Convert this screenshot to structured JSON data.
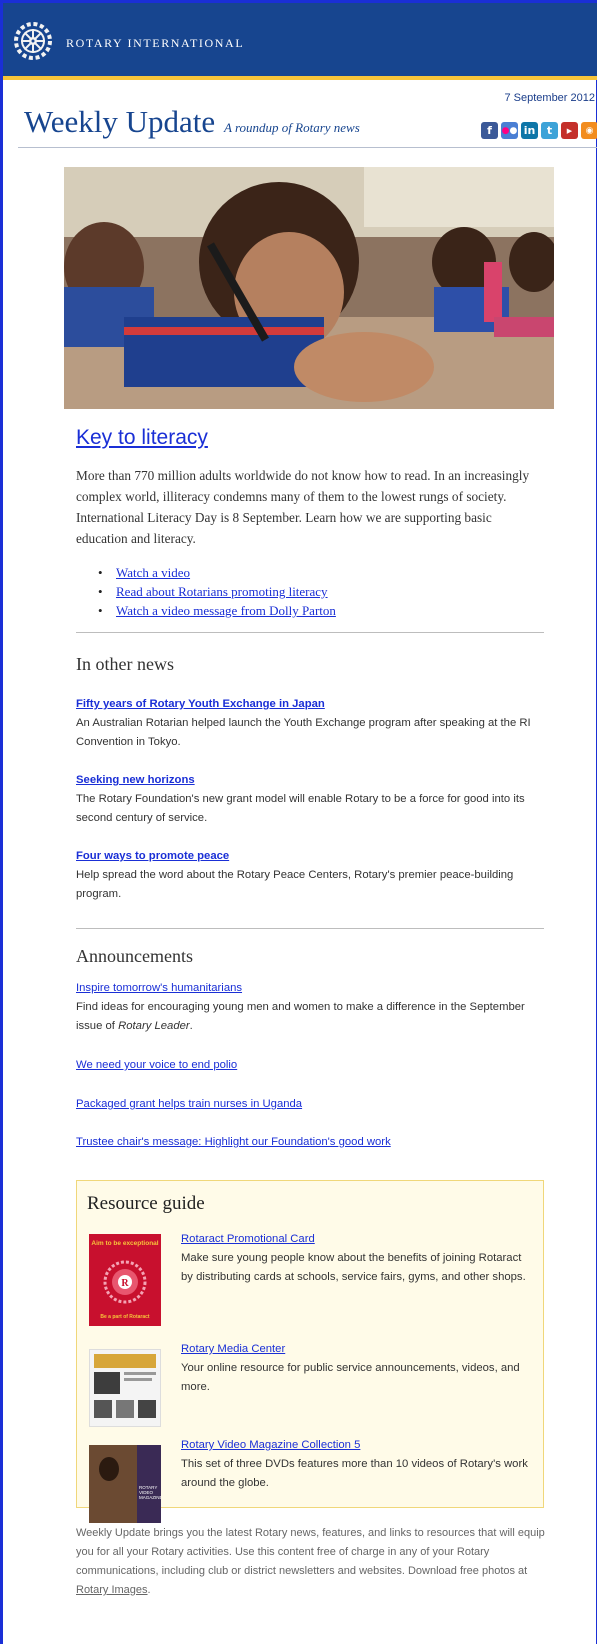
{
  "masthead": {
    "brand": "ROTARY INTERNATIONAL",
    "logo_icon": "rotary-wheel-icon",
    "colors": {
      "navy": "#17458f",
      "gold": "#f7c43a",
      "link": "#1a2fd6"
    }
  },
  "header": {
    "date": "7 September 2012",
    "title": "Weekly Update",
    "subtitle": "A roundup of Rotary news",
    "social_icons": [
      "facebook-icon",
      "flickr-icon",
      "linkedin-icon",
      "twitter-icon",
      "youtube-icon",
      "rss-icon"
    ]
  },
  "feature": {
    "title": "Key to literacy",
    "body": "More than 770 million adults worldwide do not know how to read. In an increasingly complex world, illiteracy condemns many of them to the lowest rungs of society. International Literacy Day is 8 September. Learn how we are supporting basic education and literacy.",
    "links": [
      "Watch a video",
      "Read about Rotarians promoting literacy",
      "Watch a video message from Dolly Parton"
    ]
  },
  "other_news": {
    "heading": "In other news",
    "items": [
      {
        "title": "Fifty years of Rotary Youth Exchange in Japan",
        "desc": "An Australian Rotarian helped launch the Youth Exchange program after speaking at the RI Convention in Tokyo."
      },
      {
        "title": "Seeking new horizons",
        "desc": "The Rotary Foundation's new grant model will enable Rotary to be a force for good into its second century of service."
      },
      {
        "title": "Four ways to promote peace",
        "desc": "Help spread the word about the Rotary Peace Centers, Rotary's premier peace-building program."
      }
    ]
  },
  "announcements": {
    "heading": "Announcements",
    "first": {
      "title": "Inspire tomorrow's humanitarians",
      "desc_pre": "Find ideas for encouraging young men and women to make a difference in the September issue of ",
      "desc_em": "Rotary Leader",
      "desc_post": "."
    },
    "links": [
      "We need your voice to end polio",
      "Packaged grant helps train nurses in Uganda",
      "Trustee chair's message: Highlight our Foundation's good work"
    ]
  },
  "resources": {
    "heading": "Resource guide",
    "items": [
      {
        "title": "Rotaract Promotional Card",
        "desc": "Make sure young people know about the benefits of joining Rotaract by distributing cards at schools, service fairs, gyms, and other shops.",
        "thumb_top": "Aim to be exceptional",
        "thumb_bottom": "Be a part of Rotaract"
      },
      {
        "title": "Rotary Media Center",
        "desc": "Your online resource for public service announcements, videos, and more."
      },
      {
        "title": "Rotary Video Magazine Collection 5",
        "desc": "This set of three DVDs features more than 10 videos of Rotary's work around the globe.",
        "thumb_caption": "ROTARY VIDEO MAGAZINE"
      }
    ]
  },
  "footer": {
    "text": "Weekly Update brings you the latest Rotary news, features, and links to resources that will equip you for all your Rotary activities. Use this content free of charge in any of your Rotary communications, including club or district newsletters and websites. Download free photos at ",
    "link": "Rotary Images",
    "end": "."
  }
}
